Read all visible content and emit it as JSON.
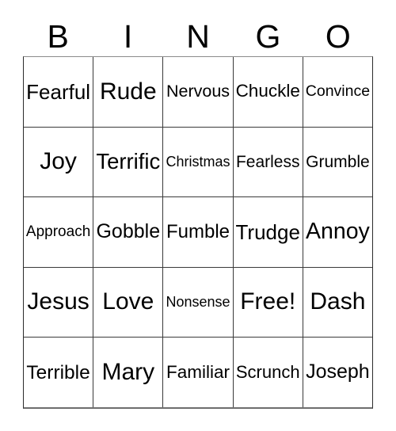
{
  "card": {
    "header_letters": [
      "B",
      "I",
      "N",
      "G",
      "O"
    ],
    "grid": {
      "columns": 5,
      "rows": 5,
      "free_space": {
        "row": 3,
        "column": 3,
        "label": "Free!"
      },
      "cells": [
        [
          {
            "label": "Fearful"
          },
          {
            "label": "Rude"
          },
          {
            "label": "Nervous"
          },
          {
            "label": "Chuckle"
          },
          {
            "label": "Convince"
          }
        ],
        [
          {
            "label": "Joy"
          },
          {
            "label": "Terrific"
          },
          {
            "label": "Christmas"
          },
          {
            "label": "Fearless"
          },
          {
            "label": "Grumble"
          }
        ],
        [
          {
            "label": "Approach"
          },
          {
            "label": "Gobble"
          },
          {
            "label": "Fumble"
          },
          {
            "label": "Trudge"
          },
          {
            "label": "Annoy"
          }
        ],
        [
          {
            "label": "Jesus"
          },
          {
            "label": "Love"
          },
          {
            "label": "Nonsense"
          },
          {
            "label": "Free!"
          },
          {
            "label": "Dash"
          }
        ],
        [
          {
            "label": "Terrible"
          },
          {
            "label": "Mary"
          },
          {
            "label": "Familiar"
          },
          {
            "label": "Scrunch"
          },
          {
            "label": "Joseph"
          }
        ]
      ]
    },
    "colors": {
      "background": "#ffffff",
      "text": "#000000",
      "grid_line": "#3a3a3a",
      "grid_border_top": "#8b8b8b",
      "grid_border_bottom": "#6e6e6e"
    }
  }
}
